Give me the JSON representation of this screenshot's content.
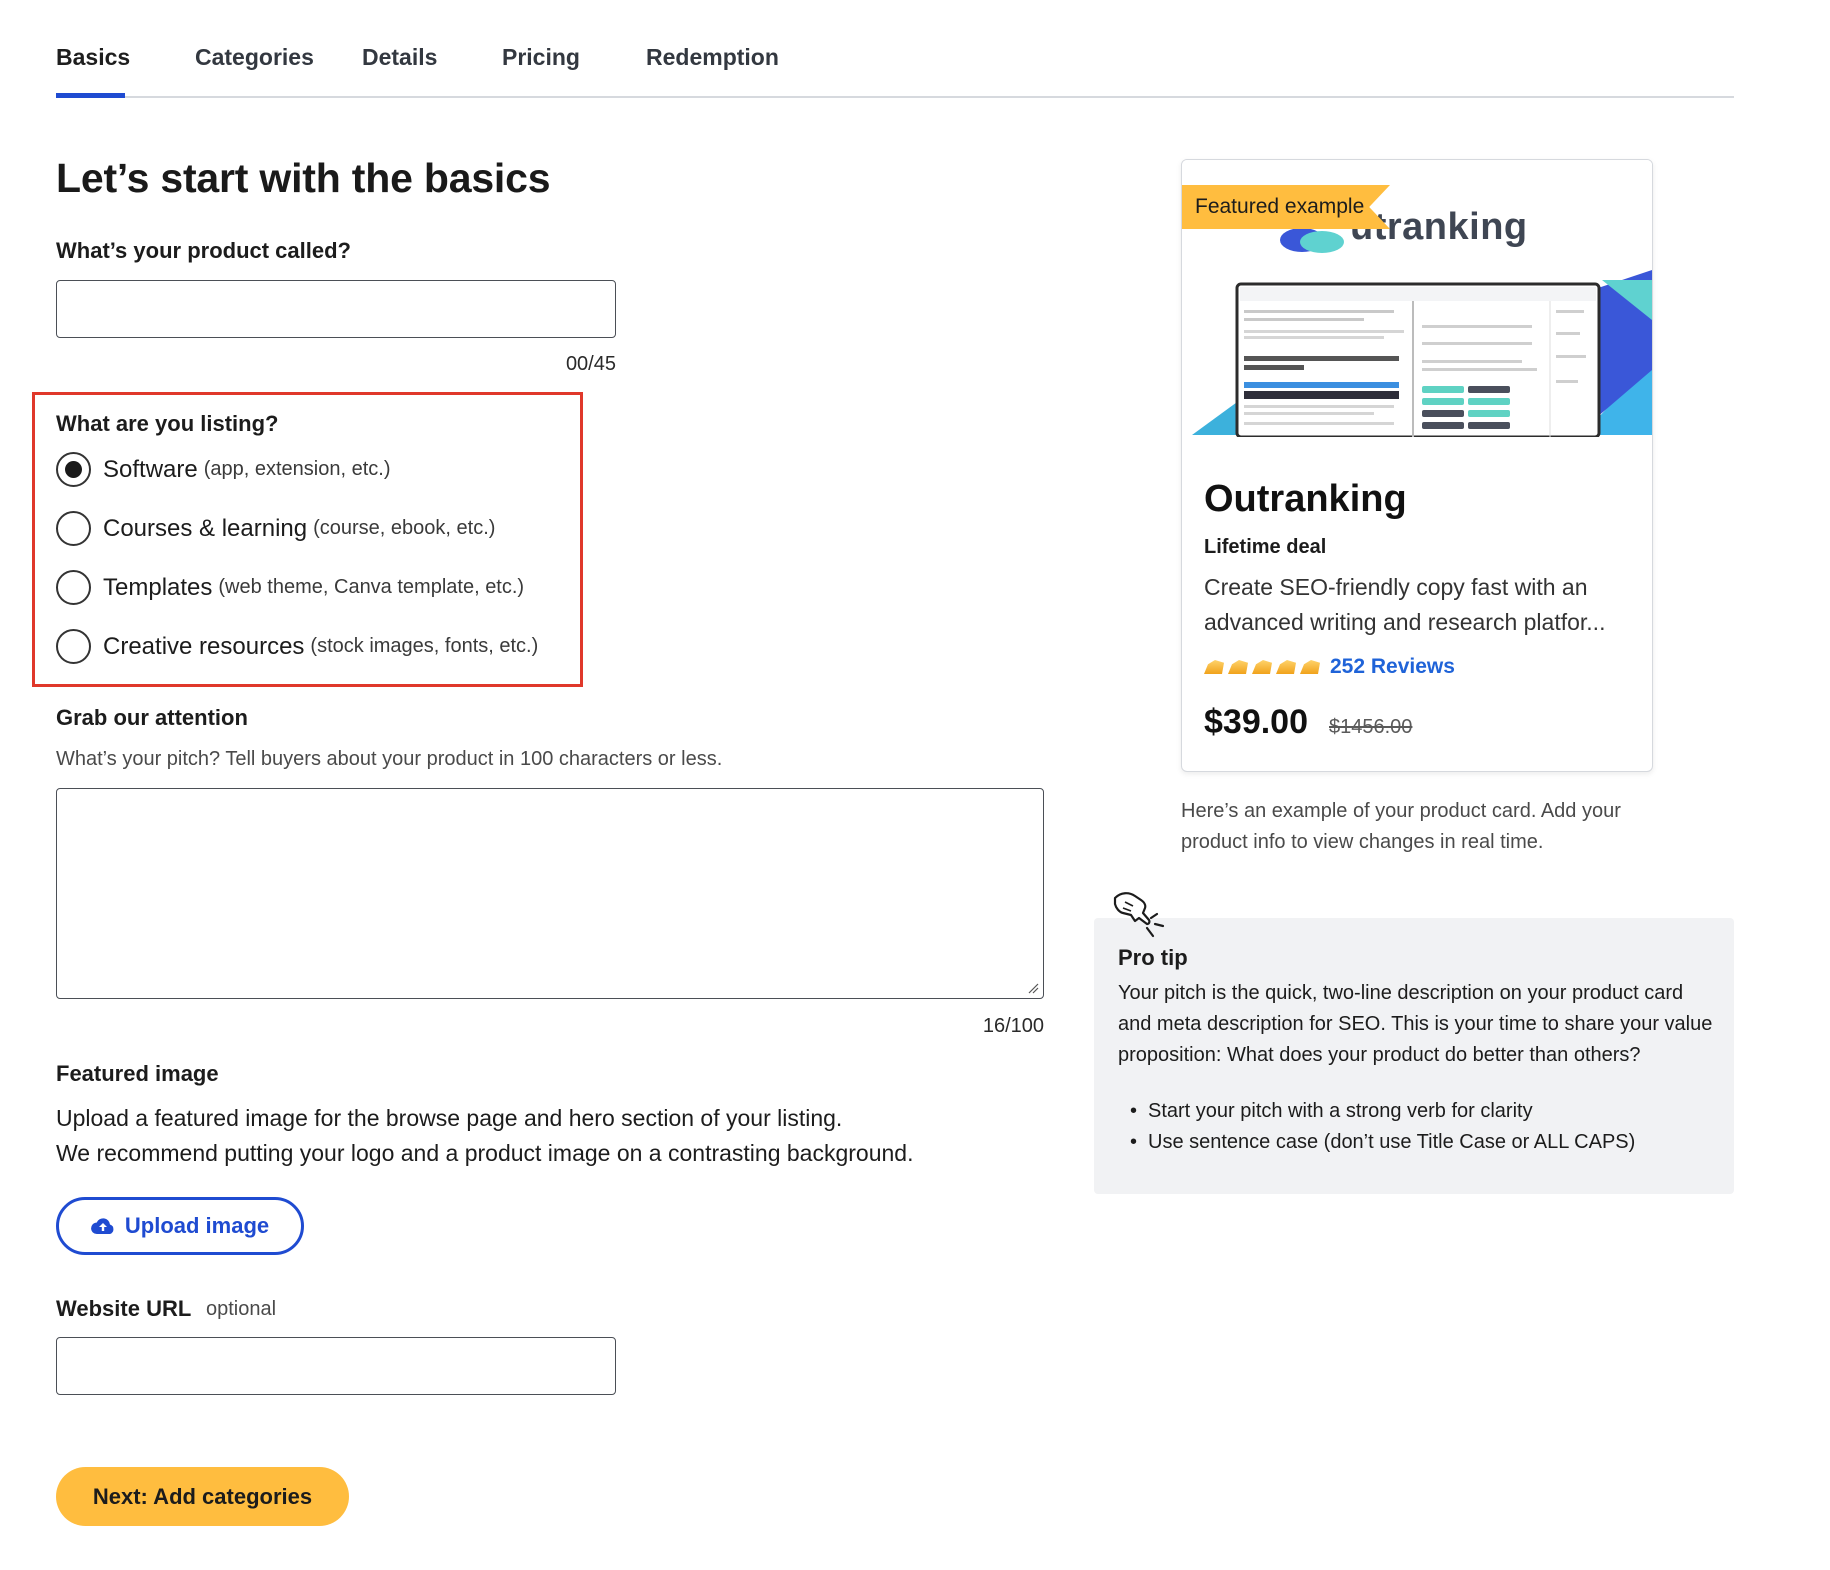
{
  "tabs": [
    {
      "label": "Basics"
    },
    {
      "label": "Categories"
    },
    {
      "label": "Details"
    },
    {
      "label": "Pricing"
    },
    {
      "label": "Redemption"
    }
  ],
  "heading": "Let’s start with the basics",
  "product_name": {
    "label": "What’s your product called?",
    "value": "",
    "counter": "00/45"
  },
  "listing": {
    "label": "What are you listing?",
    "options": [
      {
        "main": "Software",
        "sub": "(app, extension, etc.)",
        "checked": true
      },
      {
        "main": "Courses & learning",
        "sub": "(course, ebook, etc.)",
        "checked": false
      },
      {
        "main": "Templates",
        "sub": "(web theme, Canva template, etc.)",
        "checked": false
      },
      {
        "main": "Creative resources",
        "sub": "(stock images, fonts, etc.)",
        "checked": false
      }
    ]
  },
  "pitch": {
    "label": "Grab our attention",
    "helper": "What’s your pitch? Tell buyers about your product in 100 characters or less.",
    "value": "",
    "counter": "16/100"
  },
  "featured_image": {
    "label": "Featured image",
    "line1": "Upload a featured image for the browse page and hero section of your listing.",
    "line2": "We recommend putting your logo and a product image on a contrasting background.",
    "button": "Upload image"
  },
  "website": {
    "label": "Website URL",
    "optional": "optional",
    "value": ""
  },
  "next_button": "Next: Add categories",
  "card": {
    "ribbon": "Featured example",
    "brand": "utranking",
    "title": "Outranking",
    "subtitle": "Lifetime deal",
    "description": "Create SEO-friendly copy fast with an advanced writing and research platfor...",
    "rating_stars": 5,
    "reviews": "252 Reviews",
    "price": "$39.00",
    "old_price": "$1456.00"
  },
  "card_note": "Here’s an example of your product card. Add your product info to view changes in real time.",
  "protip": {
    "title": "Pro tip",
    "body": "Your pitch is the quick, two-line description on your product card and meta description for SEO. This is your time to share your value proposition: What does your product do better than others?",
    "bullets": [
      "Start your pitch with a strong verb for clarity",
      "Use sentence case (don’t use Title Case or ALL CAPS)"
    ]
  },
  "colors": {
    "accent_blue": "#1f4bd1",
    "cta_yellow": "#ffbd3f",
    "highlight_red": "#e0382a",
    "link_blue": "#1f63d8"
  }
}
